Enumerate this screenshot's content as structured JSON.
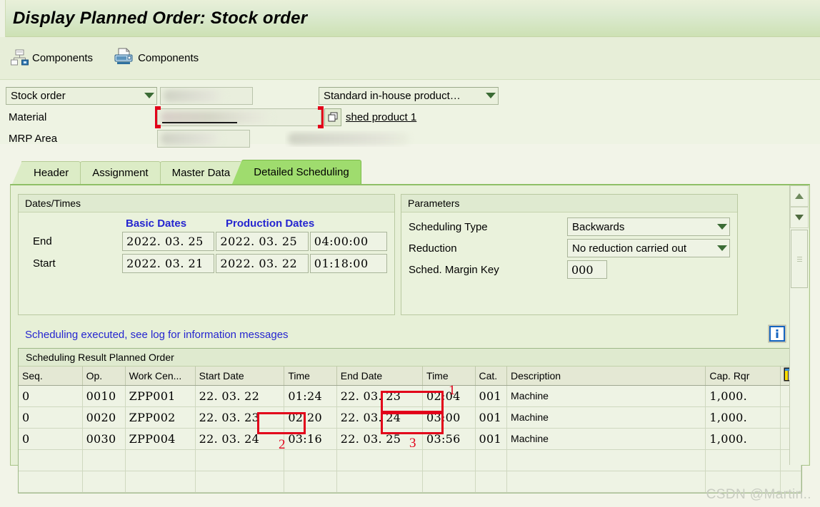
{
  "window": {
    "title": "Display Planned Order: Stock order"
  },
  "toolbar": {
    "buttons": [
      {
        "label": "Components",
        "icon": "hierarchy-icon"
      },
      {
        "label": "Components",
        "icon": "printer-icon"
      }
    ]
  },
  "form": {
    "order_type_value": "Stock order",
    "order_number_value": "",
    "production_type_value": "Standard in-house product…",
    "material_label": "Material",
    "material_value": "",
    "material_description": "shed  product 1",
    "mrp_area_label": "MRP Area",
    "mrp_area_value": ""
  },
  "tabs": [
    {
      "label": "Header",
      "active": false
    },
    {
      "label": "Assignment",
      "active": false
    },
    {
      "label": "Master Data",
      "active": false
    },
    {
      "label": "Detailed Scheduling",
      "active": true
    }
  ],
  "dates_times": {
    "group_title": "Dates/Times",
    "col_basic": "Basic Dates",
    "col_production": "Production Dates",
    "rows": [
      {
        "label": "End",
        "basic_date": "2022. 03. 25",
        "production_date": "2022. 03. 25",
        "time": "04:00:00"
      },
      {
        "label": "Start",
        "basic_date": "2022. 03. 21",
        "production_date": "2022. 03. 22",
        "time": "01:18:00"
      }
    ]
  },
  "parameters": {
    "group_title": "Parameters",
    "scheduling_type_label": "Scheduling Type",
    "scheduling_type_value": "Backwards",
    "reduction_label": "Reduction",
    "reduction_value": "No reduction carried out",
    "margin_key_label": "Sched. Margin Key",
    "margin_key_value": "000"
  },
  "message": {
    "text": "Scheduling executed, see log for information messages",
    "icon": "info-icon"
  },
  "table": {
    "title": "Scheduling Result Planned Order",
    "settings_icon": "table-settings-icon",
    "columns": [
      "Seq.",
      "Op.",
      "Work Cen...",
      "Start Date",
      "Time",
      "End Date",
      "Time",
      "Cat.",
      "Description",
      "Cap. Rqr"
    ],
    "rows": [
      {
        "seq": "0",
        "op": "0010",
        "work_center": "ZPP001",
        "start_date": "22. 03. 22",
        "start_time": "01:24",
        "end_date": "22. 03. 23",
        "end_time": "02:04",
        "cat": "001",
        "description": "Machine",
        "cap_rqr": "1,000."
      },
      {
        "seq": "0",
        "op": "0020",
        "work_center": "ZPP002",
        "start_date": "22. 03. 23",
        "start_time": "02:20",
        "end_date": "22. 03. 24",
        "end_time": "03:00",
        "cat": "001",
        "description": "Machine",
        "cap_rqr": "1,000."
      },
      {
        "seq": "0",
        "op": "0030",
        "work_center": "ZPP004",
        "start_date": "22. 03. 24",
        "start_time": "03:16",
        "end_date": "22. 03. 25",
        "end_time": "03:56",
        "cat": "001",
        "description": "Machine",
        "cap_rqr": "1,000."
      }
    ],
    "empty_rows": 2
  },
  "annotations": [
    {
      "number": "1",
      "target": "row2-end-time"
    },
    {
      "number": "2",
      "target": "row3-start-time"
    },
    {
      "number": "3",
      "target": "row3-end-time"
    }
  ],
  "watermark": {
    "text": "CSDN @Martin.."
  },
  "colors": {
    "title_bar": "#cde1b4",
    "accent_link": "#2525d0",
    "annotation_red": "#e2001a",
    "active_tab": "#9fdc6e"
  }
}
